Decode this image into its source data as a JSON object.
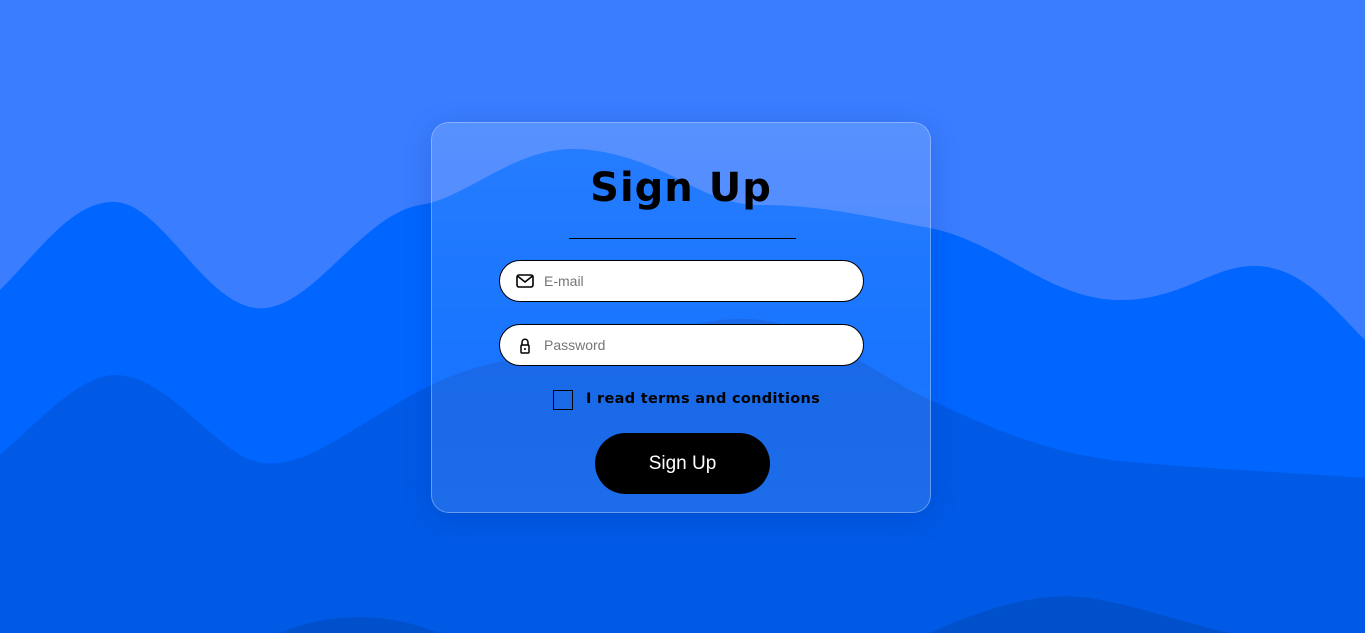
{
  "form": {
    "title": "Sign Up",
    "email": {
      "placeholder": "E-mail",
      "value": "",
      "icon": "envelope-icon"
    },
    "password": {
      "placeholder": "Password",
      "value": "",
      "icon": "lock-icon"
    },
    "terms_label": "I read terms and conditions",
    "terms_checked": false,
    "submit_label": "Sign Up"
  },
  "colors": {
    "background": "#3a7dff",
    "wave_mid": "#0066ff",
    "wave_deep": "#005ae6",
    "wave_darkest": "#0050cc",
    "button": "#000000",
    "button_text": "#ffffff",
    "field_background": "#ffffff"
  }
}
